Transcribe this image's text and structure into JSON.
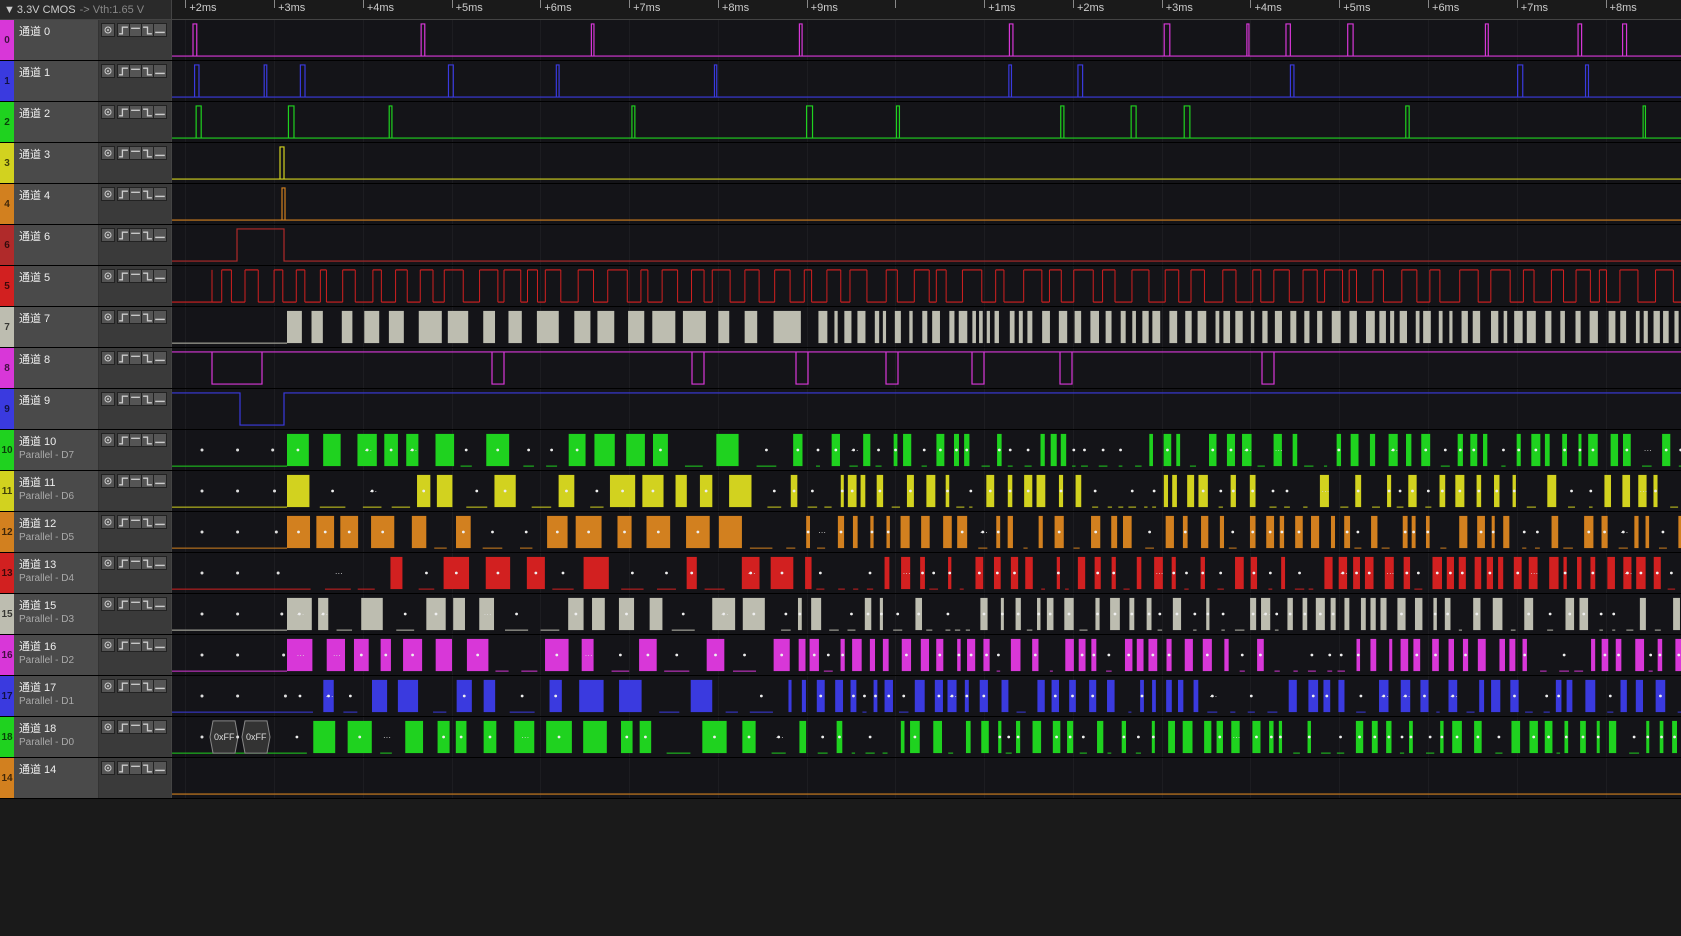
{
  "voltage": {
    "dropdown_arrow": "▼",
    "level": "3.3V CMOS",
    "vth_label": "-> Vth:1.65 V"
  },
  "time_ticks": [
    "+2ms",
    "+3ms",
    "+4ms",
    "+5ms",
    "+6ms",
    "+7ms",
    "+8ms",
    "+9ms",
    "",
    "+1ms",
    "+2ms",
    "+3ms",
    "+4ms",
    "+5ms",
    "+6ms",
    "+7ms",
    "+8ms"
  ],
  "channels": [
    {
      "idx": "0",
      "name": "通道 0",
      "sub": "",
      "color": "#d837d8"
    },
    {
      "idx": "1",
      "name": "通道 1",
      "sub": "",
      "color": "#3a3adf"
    },
    {
      "idx": "2",
      "name": "通道 2",
      "sub": "",
      "color": "#1fd21f"
    },
    {
      "idx": "3",
      "name": "通道 3",
      "sub": "",
      "color": "#d2d21f"
    },
    {
      "idx": "4",
      "name": "通道 4",
      "sub": "",
      "color": "#d2801f"
    },
    {
      "idx": "6",
      "name": "通道 6",
      "sub": "",
      "color": "#b02a2a"
    },
    {
      "idx": "5",
      "name": "通道 5",
      "sub": "",
      "color": "#d22020"
    },
    {
      "idx": "7",
      "name": "通道 7",
      "sub": "",
      "color": "#bdbdb0"
    },
    {
      "idx": "8",
      "name": "通道 8",
      "sub": "",
      "color": "#d837d8"
    },
    {
      "idx": "9",
      "name": "通道 9",
      "sub": "",
      "color": "#3a3adf"
    },
    {
      "idx": "10",
      "name": "通道 10",
      "sub": "Parallel - D7",
      "color": "#1fd21f"
    },
    {
      "idx": "11",
      "name": "通道 11",
      "sub": "Parallel - D6",
      "color": "#d2d21f"
    },
    {
      "idx": "12",
      "name": "通道 12",
      "sub": "Parallel - D5",
      "color": "#d2801f"
    },
    {
      "idx": "13",
      "name": "通道 13",
      "sub": "Parallel - D4",
      "color": "#d22020"
    },
    {
      "idx": "15",
      "name": "通道 15",
      "sub": "Parallel - D3",
      "color": "#bdbdb0"
    },
    {
      "idx": "16",
      "name": "通道 16",
      "sub": "Parallel - D2",
      "color": "#d837d8"
    },
    {
      "idx": "17",
      "name": "通道 17",
      "sub": "Parallel - D1",
      "color": "#3a3adf"
    },
    {
      "idx": "18",
      "name": "通道 18",
      "sub": "Parallel - D0",
      "color": "#1fd21f"
    },
    {
      "idx": "14",
      "name": "通道 14",
      "sub": "",
      "color": "#d2801f"
    }
  ],
  "controls": {
    "gear": "⚙",
    "trig_rise": "⌐",
    "trig_high": "‾",
    "trig_fall": "¬",
    "trig_low": "_"
  },
  "decoder_labels": {
    "ff1": "0xFF",
    "ff2": "0xFF",
    "dot": "•",
    "ellipsis": "···"
  }
}
